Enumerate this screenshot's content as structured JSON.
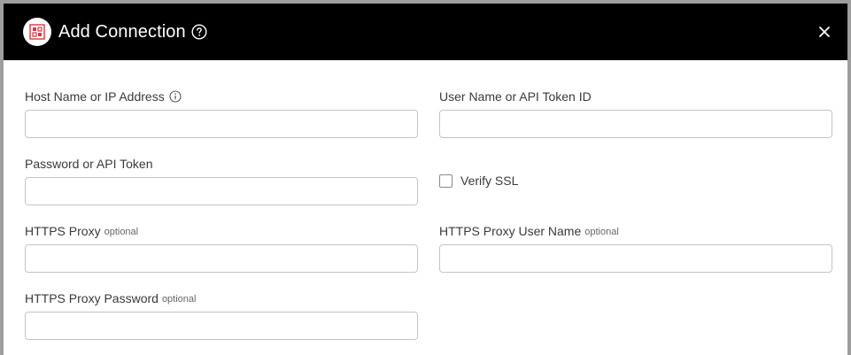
{
  "dialog": {
    "title": "Add Connection",
    "logo_icon": "integration-logo-icon",
    "help_icon": "help-circle-icon",
    "close_icon": "close-icon"
  },
  "form": {
    "host": {
      "label": "Host Name or IP Address",
      "value": "",
      "placeholder": "",
      "info_icon": "info-icon"
    },
    "user": {
      "label": "User Name or API Token ID",
      "value": "",
      "placeholder": ""
    },
    "password": {
      "label": "Password or API Token",
      "value": "",
      "placeholder": ""
    },
    "verify_ssl": {
      "label": "Verify SSL",
      "checked": false
    },
    "proxy": {
      "label": "HTTPS Proxy",
      "optional": "optional",
      "value": "",
      "placeholder": ""
    },
    "proxy_user": {
      "label": "HTTPS Proxy User Name",
      "optional": "optional",
      "value": "",
      "placeholder": ""
    },
    "proxy_password": {
      "label": "HTTPS Proxy Password",
      "optional": "optional",
      "value": "",
      "placeholder": ""
    }
  },
  "colors": {
    "header_bg": "#000000",
    "logo_accent": "#d9363e",
    "input_border": "#c4c4c4"
  }
}
